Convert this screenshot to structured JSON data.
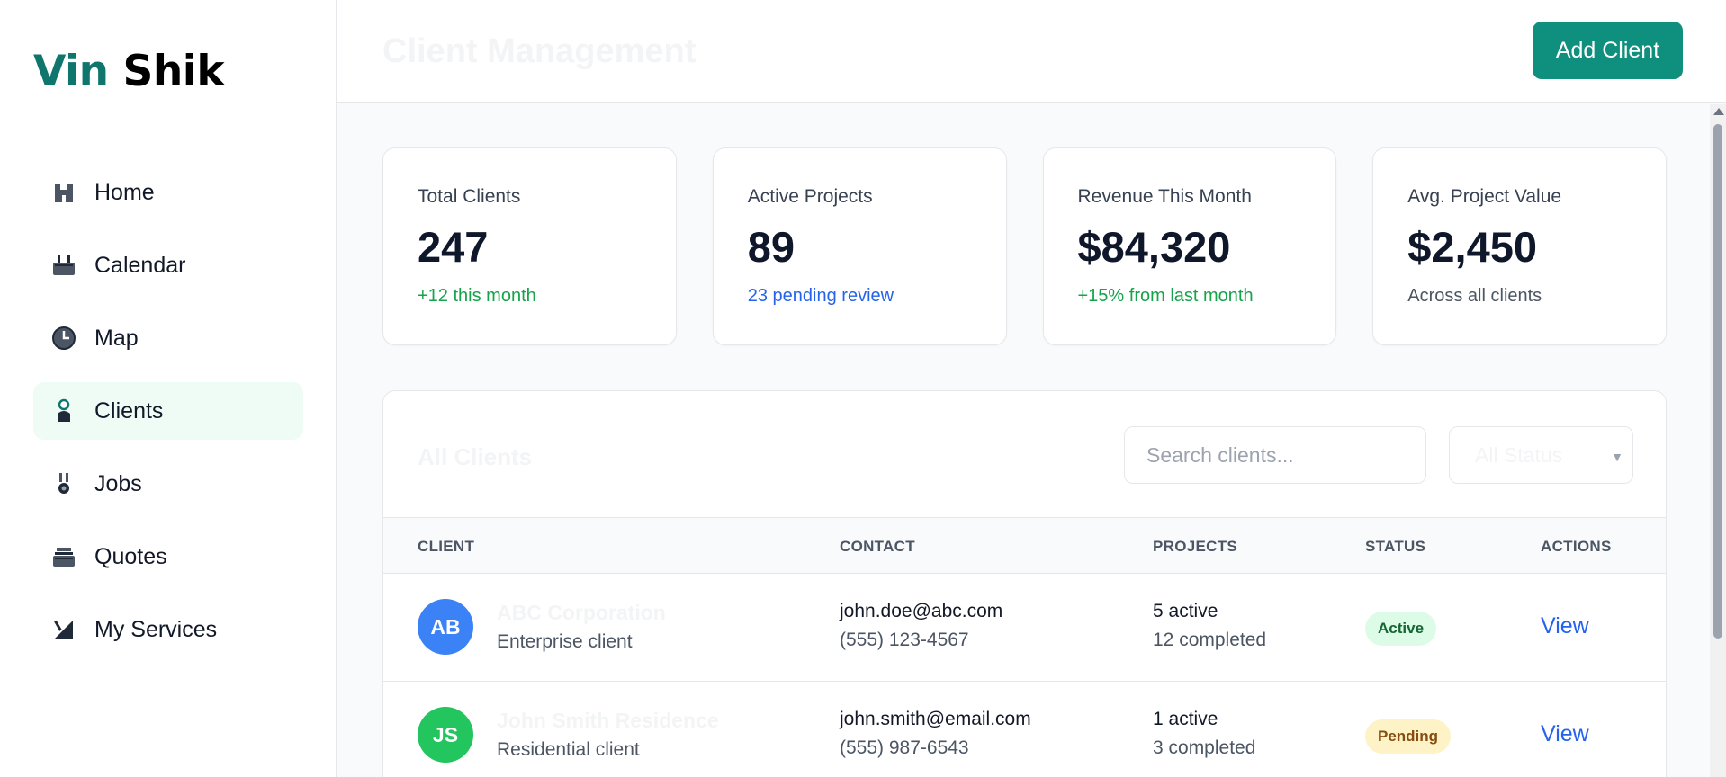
{
  "brand": {
    "part1": "Vin",
    "part2": "Shik"
  },
  "sidebar": {
    "items": [
      {
        "label": "Home",
        "icon": "home-icon"
      },
      {
        "label": "Calendar",
        "icon": "calendar-icon"
      },
      {
        "label": "Map",
        "icon": "map-icon"
      },
      {
        "label": "Clients",
        "icon": "clients-icon",
        "active": true
      },
      {
        "label": "Jobs",
        "icon": "jobs-icon"
      },
      {
        "label": "Quotes",
        "icon": "quotes-icon"
      },
      {
        "label": "My Services",
        "icon": "services-icon"
      }
    ]
  },
  "header": {
    "title": "Client Management",
    "add_button": "Add Client"
  },
  "stats": [
    {
      "label": "Total Clients",
      "value": "247",
      "sub": "+12 this month"
    },
    {
      "label": "Active Projects",
      "value": "89",
      "sub": "23 pending review"
    },
    {
      "label": "Revenue This Month",
      "value": "$84,320",
      "sub": "+15% from last month"
    },
    {
      "label": "Avg. Project Value",
      "value": "$2,450",
      "sub": "Across all clients"
    }
  ],
  "table": {
    "title": "All Clients",
    "search_placeholder": "Search clients...",
    "status_filter": "All Status",
    "columns": [
      "CLIENT",
      "CONTACT",
      "PROJECTS",
      "STATUS",
      "ACTIONS"
    ],
    "rows": [
      {
        "initials": "AB",
        "name": "ABC Corporation",
        "type": "Enterprise client",
        "email": "john.doe@abc.com",
        "phone": "(555) 123-4567",
        "active": "5 active",
        "completed": "12 completed",
        "status": "Active",
        "action": "View"
      },
      {
        "initials": "JS",
        "name": "John Smith Residence",
        "type": "Residential client",
        "email": "john.smith@email.com",
        "phone": "(555) 987-6543",
        "active": "1 active",
        "completed": "3 completed",
        "status": "Pending",
        "action": "View"
      }
    ]
  },
  "colors": {
    "brand": "#0f766e",
    "accent_button": "#0f8f7e",
    "avatar_blue": "#3b82f6",
    "avatar_green": "#22c55e",
    "active_nav_bg": "#effcf6"
  }
}
